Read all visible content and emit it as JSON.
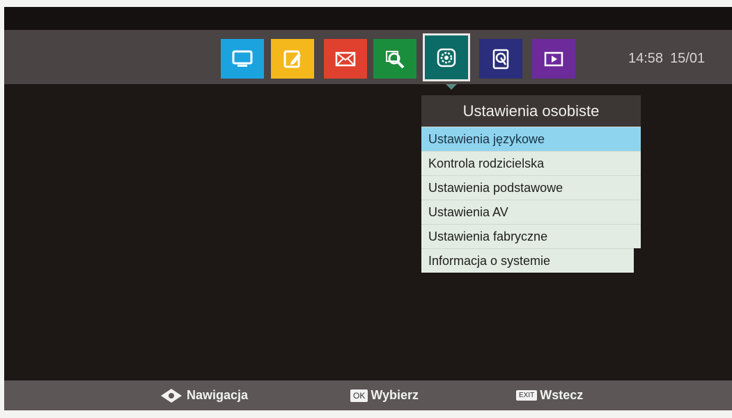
{
  "header": {
    "time": "14:58",
    "date": "15/01"
  },
  "toolbar": {
    "tiles": [
      {
        "name": "tv",
        "icon": "tv-icon",
        "color": "#1ba3e0"
      },
      {
        "name": "edit",
        "icon": "edit-icon",
        "color": "#f4b81c"
      },
      {
        "name": "mail",
        "icon": "mail-icon",
        "color": "#e0402e"
      },
      {
        "name": "search",
        "icon": "search-icon",
        "color": "#1b8e3e"
      },
      {
        "name": "settings",
        "icon": "gear-icon",
        "color": "#0c6b66",
        "active": true
      },
      {
        "name": "storage",
        "icon": "hdd-icon",
        "color": "#2a2e7c"
      },
      {
        "name": "media",
        "icon": "play-icon",
        "color": "#6c2a9a"
      }
    ]
  },
  "menu": {
    "title": "Ustawienia osobiste",
    "items": [
      "Ustawienia językowe",
      "Kontrola rodzicielska",
      "Ustawienia podstawowe",
      "Ustawienia AV",
      "Ustawienia fabryczne",
      "Informacja o systemie"
    ],
    "selected_index": 0
  },
  "footer": {
    "navigate_label": "Nawigacja",
    "ok_key": "OK",
    "ok_label": "Wybierz",
    "exit_key": "EXIT",
    "exit_label": "Wstecz"
  }
}
